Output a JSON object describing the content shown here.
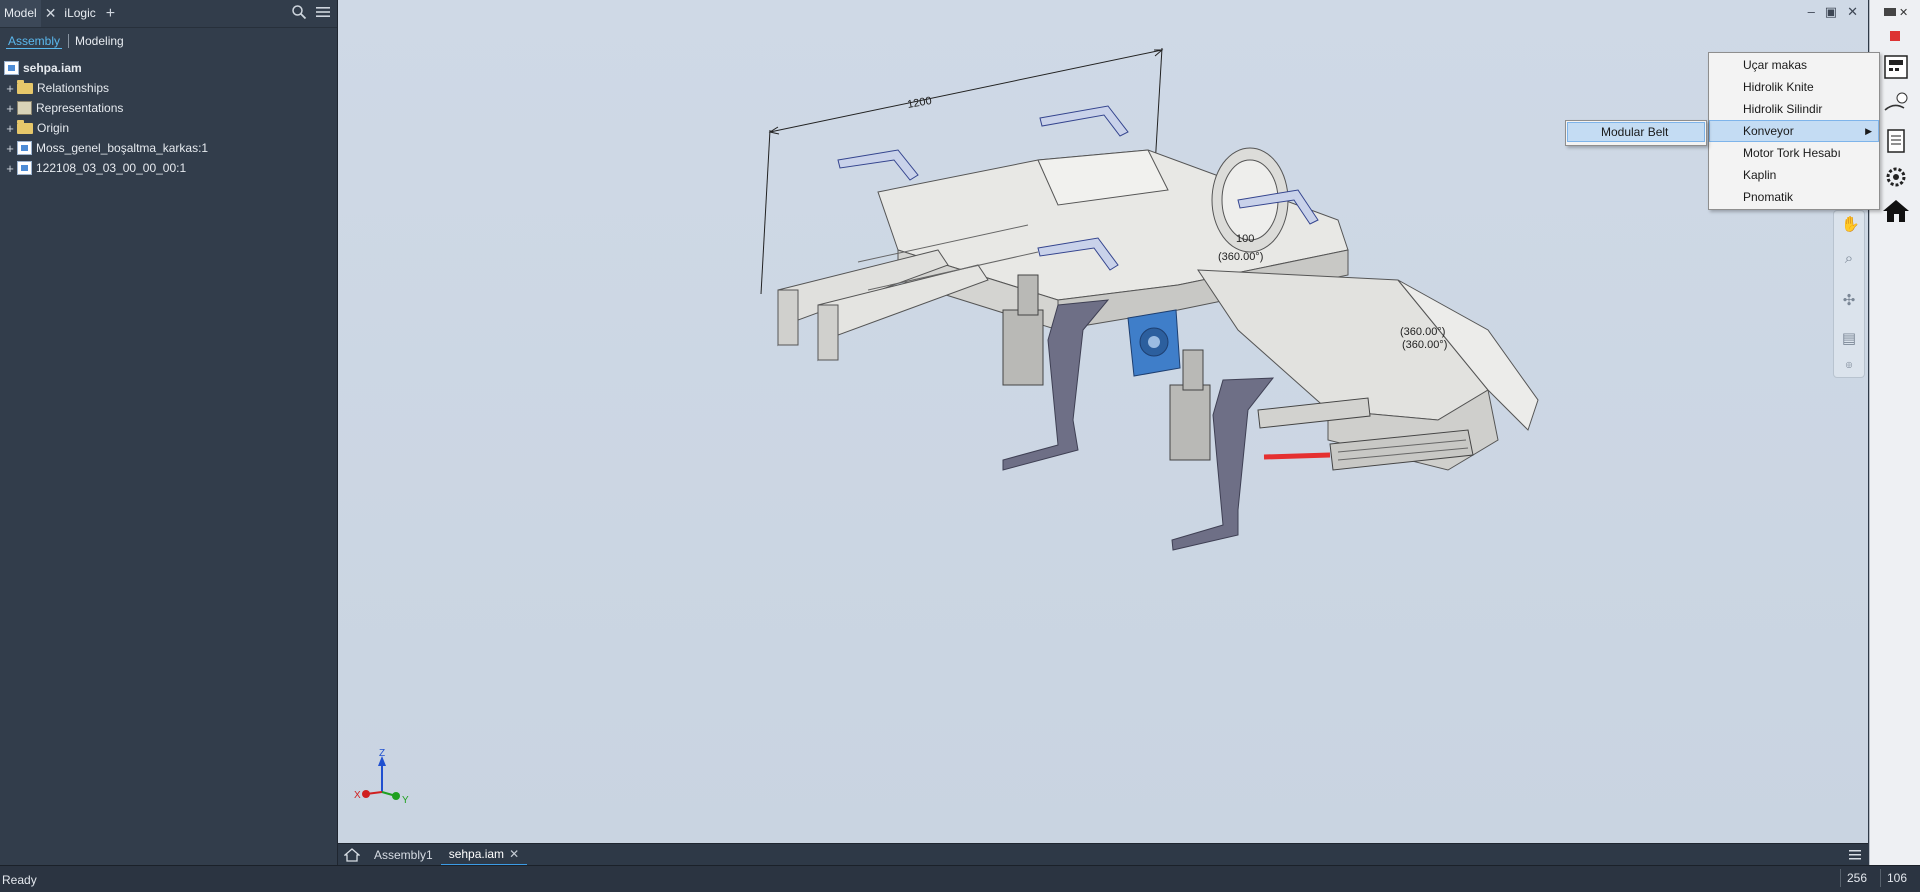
{
  "browser": {
    "tabs": [
      {
        "label": "Model",
        "active": true
      },
      {
        "label": "iLogic",
        "active": false
      }
    ],
    "modes": {
      "assembly": "Assembly",
      "modeling": "Modeling"
    },
    "root": "sehpa.iam",
    "items": [
      {
        "label": "Relationships",
        "icon": "folder-icon"
      },
      {
        "label": "Representations",
        "icon": "representations-icon"
      },
      {
        "label": "Origin",
        "icon": "folder-icon"
      },
      {
        "label": "Moss_genel_boşaltma_karkas:1",
        "icon": "subassembly-icon"
      },
      {
        "label": "122108_03_03_00_00_00:1",
        "icon": "assembly-icon"
      }
    ]
  },
  "viewport": {
    "dimension_label": "1200",
    "angle_labels": [
      "(360.00°)",
      "(360.00°)",
      "(360.00°)"
    ],
    "small_label": "100",
    "axes": {
      "z": "Z",
      "x": "X",
      "y": "Y"
    },
    "colors": {
      "background": "#cdd7e4",
      "part": "#e6e6e3",
      "accent_blue": "#3f7ec9",
      "cylinder_rod": "#e53030",
      "bracket": "#6e6f86"
    }
  },
  "context_menu": {
    "items": [
      {
        "label": "Uçar makas",
        "has_submenu": false
      },
      {
        "label": "Hidrolik Knite",
        "has_submenu": false
      },
      {
        "label": "Hidrolik Silindir",
        "has_submenu": false
      },
      {
        "label": "Konveyor",
        "has_submenu": true,
        "highlighted": true
      },
      {
        "label": "Motor Tork Hesabı",
        "has_submenu": false
      },
      {
        "label": "Kaplin",
        "has_submenu": false
      },
      {
        "label": "Pnomatik",
        "has_submenu": false
      }
    ],
    "submenu": {
      "label": "Modular Belt"
    }
  },
  "document_tabs": [
    {
      "label": "Assembly1",
      "active": false
    },
    {
      "label": "sehpa.iam",
      "active": true
    }
  ],
  "status": {
    "text": "Ready",
    "numbers": [
      "256",
      "106"
    ]
  }
}
